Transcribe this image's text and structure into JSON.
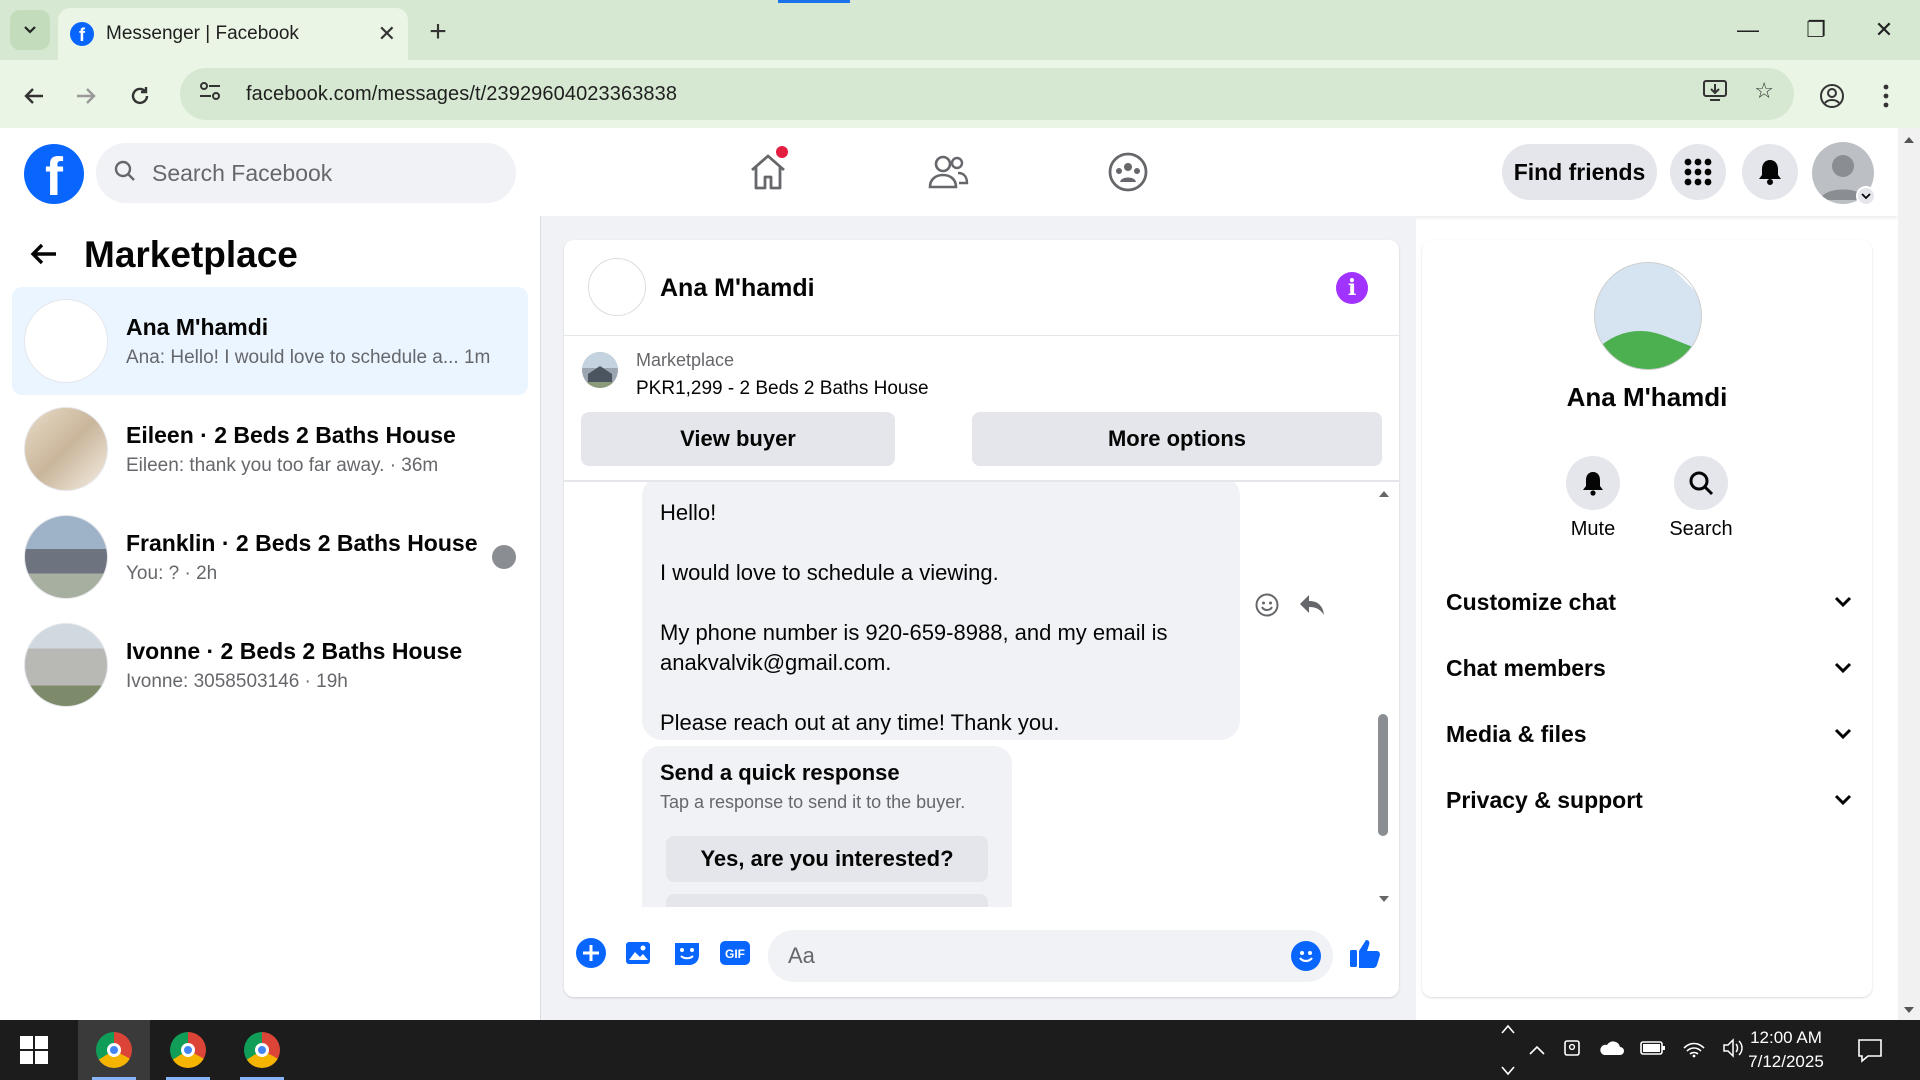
{
  "browser": {
    "tab_title": "Messenger | Facebook",
    "url": "facebook.com/messages/t/23929604023363838"
  },
  "fb": {
    "search_placeholder": "Search Facebook",
    "find_friends": "Find friends"
  },
  "left": {
    "title": "Marketplace",
    "conversations": [
      {
        "name": "Ana M'hamdi",
        "preview": "Ana: Hello! I would love to schedule a... 1m"
      },
      {
        "name": "Eileen · 2 Beds 2 Baths House",
        "preview": "Eileen: thank you too far away. · 36m"
      },
      {
        "name": "Franklin · 2 Beds 2 Baths House",
        "preview": "You: ? · 2h"
      },
      {
        "name": "Ivonne · 2 Beds 2 Baths House",
        "preview": "Ivonne: 3058503146 · 19h"
      }
    ]
  },
  "chat": {
    "name": "Ana M'hamdi",
    "marketplace_label": "Marketplace",
    "item": "PKR1,299 - 2 Beds 2 Baths House",
    "view_buyer": "View buyer",
    "more_options": "More options",
    "message": {
      "p1": "Hello!",
      "p2": "I would love to schedule a viewing.",
      "p3": "My phone number is 920-659-8988, and my email is anakvalvik@gmail.com.",
      "p4": "Please reach out at any time! Thank you."
    },
    "quick": {
      "title": "Send a quick response",
      "subtitle": "Tap a response to send it to the buyer.",
      "option1": "Yes, are you interested?"
    },
    "composer_placeholder": "Aa"
  },
  "right": {
    "name": "Ana M'hamdi",
    "mute": "Mute",
    "search": "Search",
    "rows": [
      "Customize chat",
      "Chat members",
      "Media & files",
      "Privacy & support"
    ]
  },
  "taskbar": {
    "time": "12:00 AM",
    "date": "7/12/2025"
  },
  "colors": {
    "fb_blue": "#0866ff",
    "info_purple": "#a033ff",
    "chrome_green": "#d6e8d1"
  }
}
